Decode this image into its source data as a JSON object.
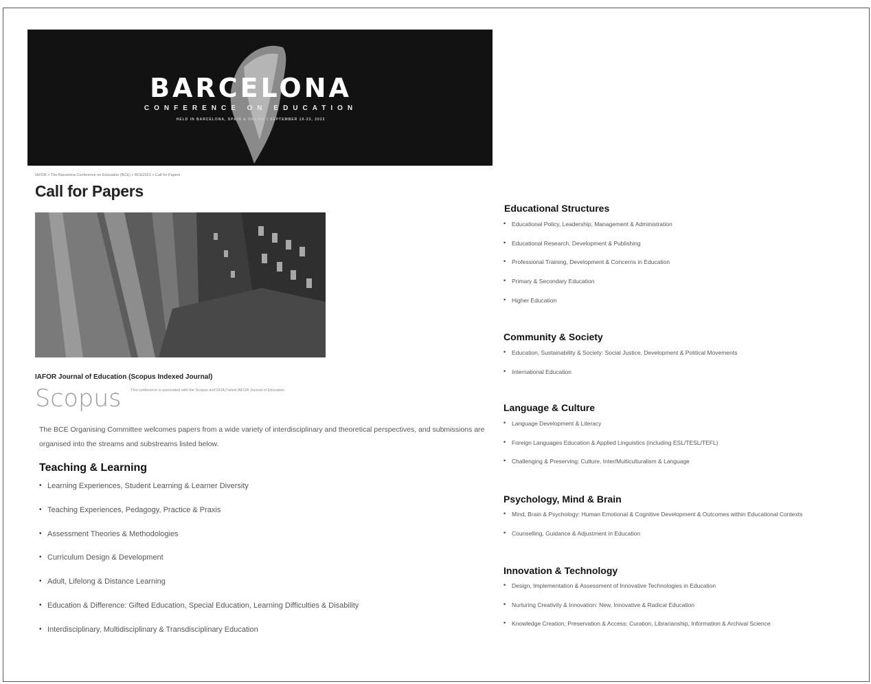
{
  "banner": {
    "title": "BARCELONA",
    "subtitle": "CONFERENCE ON EDUCATION",
    "held": "HELD IN BARCELONA, SPAIN & ONLINE | SEPTEMBER 19-23, 2023"
  },
  "breadcrumb": "IAFOR > The Barcelona Conference on Education (BCE) > BCE2023 > Call for Papers",
  "page_title": "Call for Papers",
  "journal": {
    "title": "IAFOR Journal of Education (Scopus Indexed Journal)",
    "scopus_logo": "Scopus",
    "note": "This conference is associated with the Scopus and DOAJ listed IAFOR Journal of Education"
  },
  "intro": "The BCE Organising Committee welcomes papers from a wide variety of interdisciplinary and theoretical perspectives, and submissions are organised into the streams and substreams listed below.",
  "teaching": {
    "title": "Teaching & Learning",
    "items": [
      "Learning Experiences, Student Learning & Learner Diversity",
      "Teaching Experiences, Pedagogy, Practice & Praxis",
      "Assessment Theories & Methodologies",
      "Curriculum Design & Development",
      "Adult, Lifelong & Distance Learning",
      "Education & Difference: Gifted Education, Special Education, Learning Difficulties & Disability",
      "Interdisciplinary, Multidisciplinary & Transdisciplinary Education"
    ]
  },
  "structures": {
    "title": "Educational Structures",
    "items": [
      "Educational Policy, Leadership, Management & Administration",
      "Educational Research, Development & Publishing",
      "Professional Training, Development & Concerns in Education",
      "Primary & Secondary Education",
      "Higher Education"
    ]
  },
  "community": {
    "title": "Community & Society",
    "items": [
      "Education, Sustainability & Society: Social Justice, Development & Political Movements",
      "International Education"
    ]
  },
  "language": {
    "title": "Language & Culture",
    "items": [
      "Language Development & Literacy",
      "Foreign Languages Education & Applied Linguistics (including ESL/TESL/TEFL)",
      "Challenging & Preserving: Culture, Inter/Multiculturalism & Language"
    ]
  },
  "psychology": {
    "title": "Psychology, Mind & Brain",
    "items": [
      "Mind, Brain & Psychology: Human Emotional & Cognitive Development & Outcomes within Educational Contexts",
      "Counselling, Guidance & Adjustment in Education"
    ]
  },
  "innovation": {
    "title": "Innovation & Technology",
    "items": [
      "Design, Implementation & Assessment of Innovative Technologies in Education",
      "Nurturing Creativity & Innovation: New, Innovative & Radical Education",
      "Knowledge Creation, Preservation & Access: Curation, Librarianship, Information & Archival Science"
    ]
  }
}
